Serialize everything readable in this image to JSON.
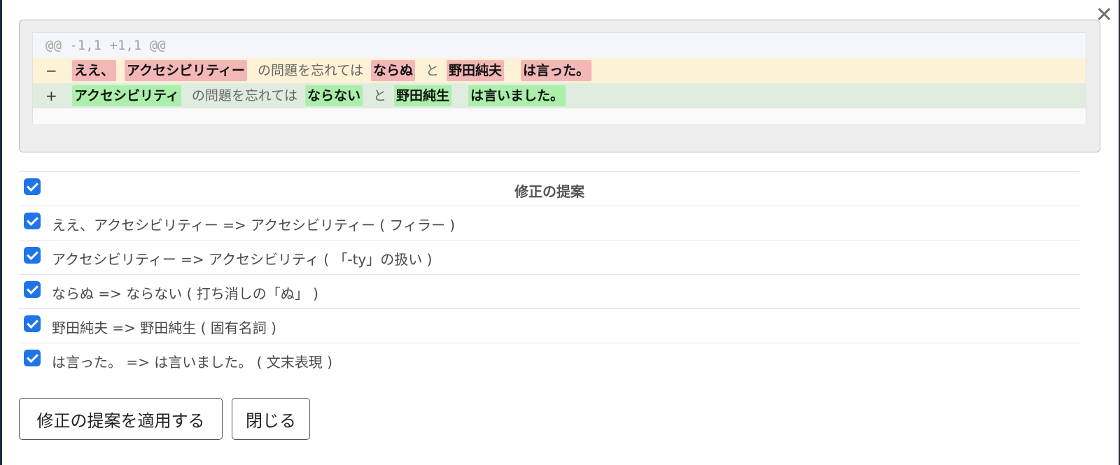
{
  "dialog": {
    "close_glyph": "✕"
  },
  "diff": {
    "hunk_header": "@@ -1,1 +1,1 @@",
    "removed_line": {
      "prefix": "−",
      "segments": [
        {
          "text": "ええ、",
          "type": "del"
        },
        {
          "text": "アクセシビリティー",
          "type": "del"
        },
        {
          "text": "の問題を忘れては",
          "type": "plain"
        },
        {
          "text": "ならぬ",
          "type": "del"
        },
        {
          "text": "と",
          "type": "plain"
        },
        {
          "text": "野田純夫",
          "type": "del"
        },
        {
          "text": "は言った。",
          "type": "del"
        }
      ]
    },
    "added_line": {
      "prefix": "+",
      "segments": [
        {
          "text": "アクセシビリティ",
          "type": "add"
        },
        {
          "text": "の問題を忘れては",
          "type": "plain"
        },
        {
          "text": "ならない",
          "type": "add"
        },
        {
          "text": "と",
          "type": "plain"
        },
        {
          "text": "野田純生",
          "type": "add"
        },
        {
          "text": "は言いました。",
          "type": "add"
        }
      ]
    }
  },
  "suggestions": {
    "header": "修正の提案",
    "items": [
      "ええ、アクセシビリティー => アクセシビリティー ( フィラー )",
      "アクセシビリティー => アクセシビリティ ( 「-ty」の扱い )",
      "ならぬ => ならない ( 打ち消しの「ぬ」 )",
      "野田純夫 => 野田純生 ( 固有名詞 )",
      "は言った。 => は言いました。 ( 文末表現 )"
    ]
  },
  "buttons": {
    "apply_label": "修正の提案を適用する",
    "close_label": "閉じる"
  },
  "colors": {
    "checkbox": "#1f74e8",
    "deleted_highlight": "#f3b7b7",
    "added_highlight": "#abefab",
    "deleted_line_bg": "#fdf1d6",
    "added_line_bg": "#e0ecdf"
  }
}
